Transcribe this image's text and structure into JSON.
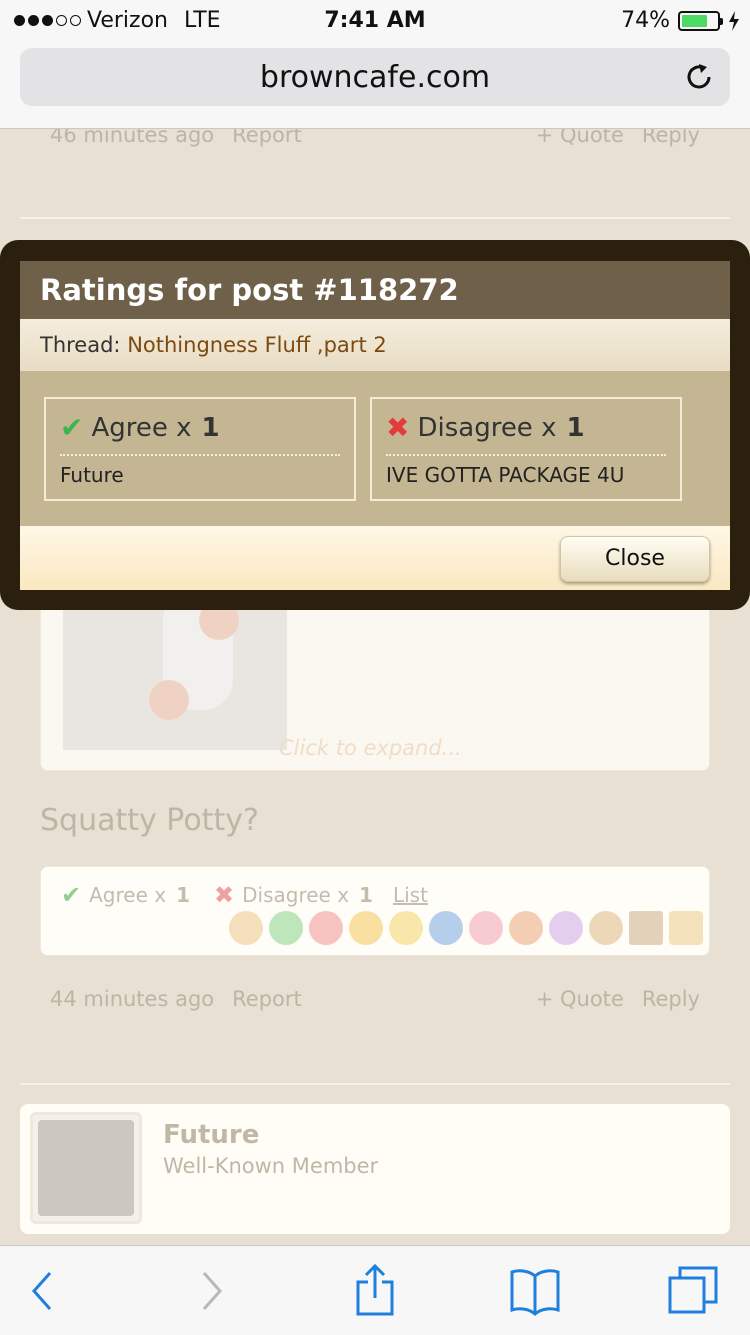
{
  "status_bar": {
    "carrier": "Verizon",
    "network": "LTE",
    "time": "7:41 AM",
    "battery": "74%",
    "battery_level": 0.74,
    "signal_bars": 3
  },
  "browser": {
    "url": "browncafe.com"
  },
  "page": {
    "prev_post_meta": {
      "time": "46 minutes ago",
      "report": "Report",
      "quote": "+ Quote",
      "reply": "Reply"
    },
    "quote": {
      "expand": "Click to expand..."
    },
    "post_text": "Squatty Potty?",
    "post_ratings": {
      "agree": "Agree x",
      "agree_count": "1",
      "disagree": "Disagree x",
      "disagree_count": "1",
      "list": "List"
    },
    "post_meta": {
      "time": "44 minutes ago",
      "report": "Report",
      "quote": "+ Quote",
      "reply": "Reply"
    },
    "member": {
      "name": "Future",
      "title": "Well-Known Member"
    }
  },
  "overlay": {
    "title": "Ratings for post #118272",
    "thread_label": "Thread:",
    "thread_link": "Nothingness Fluff ,part 2",
    "ratings": [
      {
        "label": "Agree x",
        "count": "1",
        "user": "Future",
        "icon": "check-icon"
      },
      {
        "label": "Disagree x",
        "count": "1",
        "user": "IVE GOTTA PACKAGE 4U",
        "icon": "x-icon"
      }
    ],
    "close": "Close"
  },
  "toolbar": {
    "icons": [
      "back-icon",
      "forward-icon",
      "share-icon",
      "bookmarks-icon",
      "tabs-icon"
    ]
  },
  "colors": {
    "accent": "#7a4a10",
    "overlay_title_bg": "#6f6049",
    "overlay_body_bg": "#c5b693"
  }
}
